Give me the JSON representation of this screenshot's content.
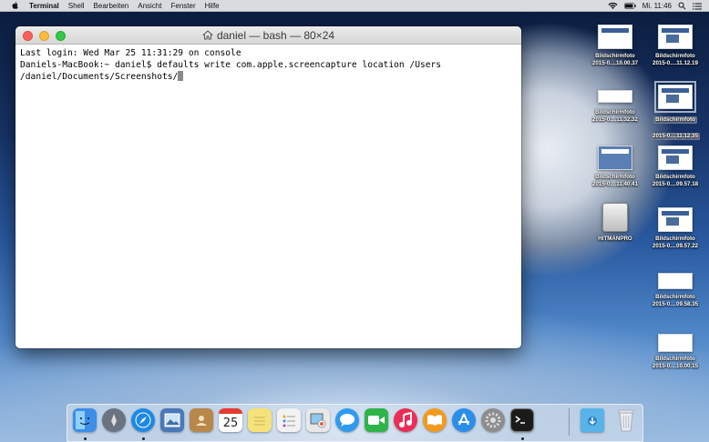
{
  "menubar": {
    "app_name": "Terminal",
    "items": [
      "Shell",
      "Bearbeiten",
      "Ansicht",
      "Fenster",
      "Hilfe"
    ],
    "clock": "Mi. 11:46"
  },
  "window": {
    "title": "daniel — bash — 80×24",
    "lines": [
      "Last login: Wed Mar 25 11:31:29 on console",
      "Daniels-MacBook:~ daniel$ defaults write com.apple.screencapture location /Users",
      "/daniel/Documents/Screenshots/"
    ]
  },
  "desktop": {
    "icons": [
      {
        "name": "Bildschirmfoto",
        "sub": "2015-0....10.00.37"
      },
      {
        "name": "Bildschirmfoto",
        "sub": "2015-0....11.12.19"
      },
      {
        "name": "Bildschirmfoto",
        "sub": "2015-0....11.32.32"
      },
      {
        "name": "Bildschirmfoto",
        "sub": "2015-0....11.12.35"
      },
      {
        "name": "Bildschirmfoto",
        "sub": "2015-0....11.40.41"
      },
      {
        "name": "Bildschirmfoto",
        "sub": "2015-0....09.57.18"
      },
      {
        "name": "HITMANPRO",
        "sub": ""
      },
      {
        "name": "Bildschirmfoto",
        "sub": "2015-0....09.57.22"
      },
      {
        "name": "Bildschirmfoto",
        "sub": "2015-0....09.58.35"
      },
      {
        "name": "Bildschirmfoto",
        "sub": "2015-0....10.00.15"
      }
    ]
  },
  "dock": {
    "calendar_day": "25",
    "apps": [
      {
        "icon": "finder-icon",
        "color": "#3b8fe8"
      },
      {
        "icon": "launchpad-icon",
        "color": "#6b7280"
      },
      {
        "icon": "safari-icon",
        "color": "#1e88e5"
      },
      {
        "icon": "preview-icon",
        "color": "#4a78b8"
      },
      {
        "icon": "contacts-icon",
        "color": "#b8874b"
      },
      {
        "icon": "calendar-icon",
        "color": "#ffffff"
      },
      {
        "icon": "notes-icon",
        "color": "#f6e27a"
      },
      {
        "icon": "reminders-icon",
        "color": "#f2f2f2"
      },
      {
        "icon": "photos-icon",
        "color": "#e8e8e8"
      },
      {
        "icon": "messages-icon",
        "color": "#2f9bf0"
      },
      {
        "icon": "facetime-icon",
        "color": "#2fb44a"
      },
      {
        "icon": "itunes-icon",
        "color": "#ec2d55"
      },
      {
        "icon": "ibooks-icon",
        "color": "#f39a1c"
      },
      {
        "icon": "appstore-icon",
        "color": "#2b8ee8"
      },
      {
        "icon": "system-preferences-icon",
        "color": "#8d8d8d"
      },
      {
        "icon": "terminal-icon",
        "color": "#1b1b1b"
      },
      {
        "icon": "downloads-folder-icon",
        "color": "#58b3e8"
      },
      {
        "icon": "trash-icon",
        "color": "#dfe5ea"
      }
    ]
  }
}
